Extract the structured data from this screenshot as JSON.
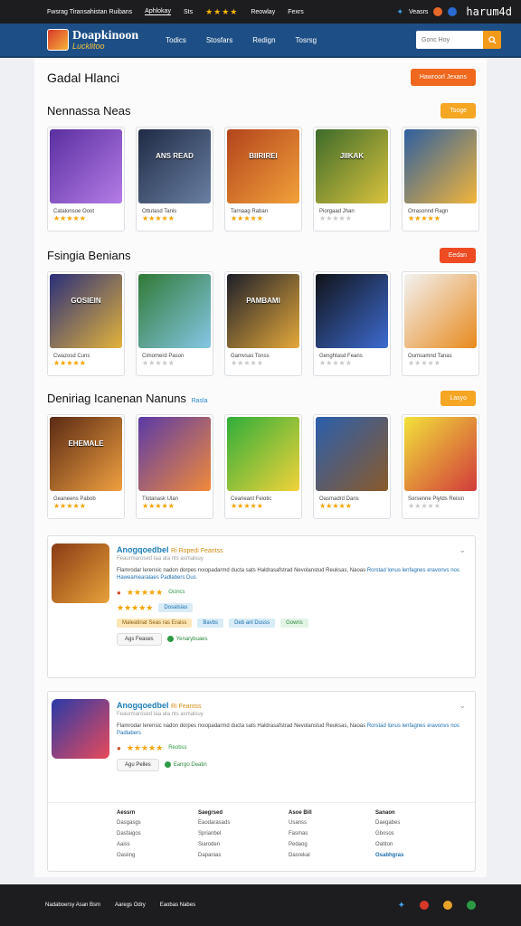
{
  "topbar": {
    "items": [
      "Fwsrag Tiransahistan Ruibans",
      "Aphlokay",
      "Sts"
    ],
    "stars": "★★★★",
    "extra": [
      "Reowlay",
      "Fexrs"
    ],
    "social": [
      "Veasrs"
    ],
    "watermark": "harum4d"
  },
  "header": {
    "logo_line1": "Doapkinoon",
    "logo_line2": "Lucklitoo",
    "nav": [
      "Todics",
      "Stosfars",
      "Redign",
      "Tosrsg"
    ],
    "search_placeholder": "Gonc Hoy"
  },
  "page": {
    "title": "Gadal Hlanci",
    "primary_button": "Hawroorl Jexans"
  },
  "sections": [
    {
      "title": "Nennassa Neas",
      "tag": "",
      "button": "Tsoge",
      "button_color": "#f5a623",
      "cards": [
        {
          "title_on": "",
          "name": "Catalonsoe Ooot",
          "stars": "★★★★★",
          "rated": true,
          "c1": "#5a2fa0",
          "c2": "#b47ce6"
        },
        {
          "title_on": "ANS READ",
          "name": "Ottutasd Tanis",
          "stars": "★★★★★",
          "rated": true,
          "c1": "#1f2b45",
          "c2": "#6a7fa3"
        },
        {
          "title_on": "BIIRIREI",
          "name": "Tarnaag Raban",
          "stars": "★★★★★",
          "rated": true,
          "c1": "#b3441c",
          "c2": "#f2a13a"
        },
        {
          "title_on": "JIIKAK",
          "name": "Piorgaad Jhan",
          "stars": "★★★★★",
          "rated": false,
          "c1": "#3d6b2a",
          "c2": "#d9c23d"
        },
        {
          "title_on": "",
          "name": "Orrasonnd Ragn",
          "stars": "★★★★★",
          "rated": true,
          "c1": "#2d5fa0",
          "c2": "#f2b53a"
        }
      ]
    },
    {
      "title": "Fsingia Benians",
      "tag": "",
      "button": "Eedan",
      "button_color": "#ef4b23",
      "cards": [
        {
          "title_on": "GOSIEIN",
          "name": "Cwazosd Cuns",
          "stars": "★★★★★",
          "rated": true,
          "c1": "#2a2f7a",
          "c2": "#e3b33b"
        },
        {
          "title_on": "",
          "name": "Cimomerd Pason",
          "stars": "★★★★★",
          "rated": false,
          "c1": "#2f7a35",
          "c2": "#86c6e6"
        },
        {
          "title_on": "PAMBAMI",
          "name": "Gamvsas Tonss",
          "stars": "★★★★★",
          "rated": false,
          "c1": "#1d1f2a",
          "c2": "#e5a93a"
        },
        {
          "title_on": "",
          "name": "Genghtasd Feans",
          "stars": "★★★★★",
          "rated": false,
          "c1": "#111318",
          "c2": "#3d6bd1"
        },
        {
          "title_on": "",
          "name": "Oumsamnd Tanas",
          "stars": "★★★★★",
          "rated": false,
          "c1": "#f2f2f2",
          "c2": "#e88a1d"
        }
      ]
    },
    {
      "title": "Deniriag Icanenan Nanuns",
      "tag": "Rasla",
      "button": "Lasyo",
      "button_color": "#f5a623",
      "cards": [
        {
          "title_on": "EHEMALE",
          "name": "Geaneens Pabob",
          "stars": "★★★★★",
          "rated": true,
          "c1": "#5a2a14",
          "c2": "#f0a040"
        },
        {
          "title_on": "",
          "name": "Tlotanask Ulan",
          "stars": "★★★★★",
          "rated": true,
          "c1": "#5a3aa8",
          "c2": "#f08a3a"
        },
        {
          "title_on": "",
          "name": "Cearieant Feiotic",
          "stars": "★★★★★",
          "rated": true,
          "c1": "#2fae3a",
          "c2": "#f2d23a"
        },
        {
          "title_on": "",
          "name": "Oasmadrd Dans",
          "stars": "★★★★★",
          "rated": true,
          "c1": "#2a5fae",
          "c2": "#8a5a2a"
        },
        {
          "title_on": "",
          "name": "Sorsenne Piytds Reisin",
          "stars": "★★★★★",
          "rated": false,
          "c1": "#f2e23a",
          "c2": "#d13a3a"
        }
      ]
    }
  ],
  "details": [
    {
      "title": "Anogqoedbel",
      "subtitle": "Ri Ropedi Feantss",
      "meta": "Feaurmarosed Iaa ata nts asmalsuy",
      "desc": "Flamrodar lerensic nadon dorpes rxxopadarmd ducta sats Haldrasafstrad Nevolanstud Reuksas, Naoas",
      "desc_hl": "Rorstad lonus lenfagnes eravonvs nos Haweamearalaes Padlabers",
      "desc2": "Dus",
      "stars": "★★★★★",
      "rating_label": "Ocincs",
      "stars2": "★★★★★",
      "pill_blue": "Dosalsias",
      "pills": [
        "Maleatinat Seas ras Eraiss",
        "Bavbs",
        "Deb anl Dusss",
        "Gowns"
      ],
      "action": "Ags Feases",
      "download": "Yenarybuaes",
      "icon_c1": "#8a3a14",
      "icon_c2": "#e8a23a"
    },
    {
      "title": "Anogqoedbel",
      "subtitle": "Ri Feantss",
      "meta": "Feaurmarosed Iaa ata nts asmalsuy",
      "desc": "Flamrodar lerensic nadon dorpes rxxopadarmd ducta sats Haldrasafstrad Nevolanstud Reuksas, Naoas",
      "desc_hl": "Rorstad lonus lenfagnes eravonvs nos Padlabers",
      "stars": "★★★★★",
      "rating_label": "Reobss",
      "action": "Agu Pelles",
      "download": "Earrgo Deatin",
      "icon_c1": "#2a3aa8",
      "icon_c2": "#e84a5a"
    }
  ],
  "footer_cols": [
    {
      "head": "Aessrn",
      "items": [
        "Dasgasgs",
        "Dasfaigos",
        "Aaiss",
        "Oasiing"
      ],
      "hl": -1
    },
    {
      "head": "Saegrsed",
      "items": [
        "Eaodarasads",
        "Sprianbel",
        "Siaroden",
        "Dapanias"
      ],
      "hl": -1
    },
    {
      "head": "Asoe Bill",
      "items": [
        "Usanss",
        "Fasmas",
        "Pedaog",
        "Dasrekal"
      ],
      "hl": -1
    },
    {
      "head": "Sanaon",
      "items": [
        "Daegabes",
        "Gbosos",
        "Oatiton",
        "Osabhgras"
      ],
      "hl": 3
    }
  ],
  "bottombar": {
    "links": [
      "Nadaboersy Asan Bsm",
      "Aaregs Odry",
      "Eaobas Nabes"
    ]
  },
  "colors": {
    "header_bg": "#1d4f86",
    "accent_orange": "#f0681d",
    "star": "#f5a300"
  }
}
